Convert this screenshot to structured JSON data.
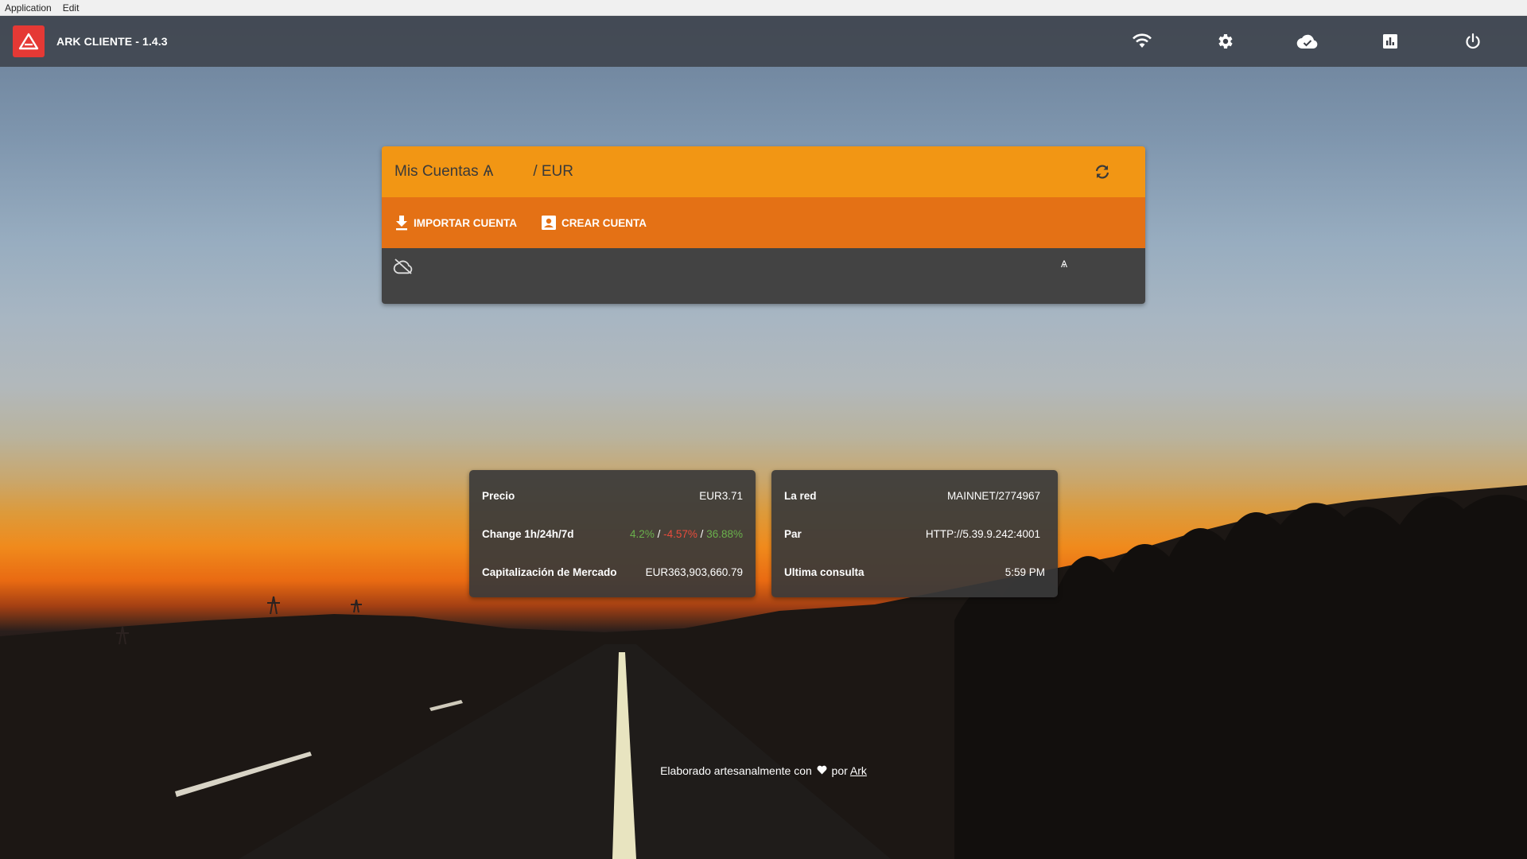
{
  "menubar": {
    "items": [
      "Application",
      "Edit"
    ]
  },
  "toolbar": {
    "title": "ARK CLIENTE - 1.4.3",
    "icons": [
      "wifi-icon",
      "settings-icon",
      "cloud-done-icon",
      "chart-icon",
      "power-icon"
    ]
  },
  "accounts": {
    "title": "Mis Cuentas",
    "symbol": "Ѧ",
    "currency": "/ EUR",
    "import_label": "IMPORTAR CUENTA",
    "create_label": "CREAR CUENTA",
    "balance_symbol": "Ѧ"
  },
  "market": {
    "price_label": "Precio",
    "price_value": "EUR3.71",
    "change_label": "Change 1h/24h/7d",
    "change_1h": "4.2%",
    "change_24h": "-4.57%",
    "change_7d": "36.88%",
    "sep": "/",
    "cap_label": "Capitalización de Mercado",
    "cap_value": "EUR363,903,660.79"
  },
  "network": {
    "net_label": "La red",
    "net_value": "MAINNET/2774967",
    "peer_label": "Par",
    "peer_value": "HTTP://5.39.9.242:4001",
    "last_label": "Ultima consulta",
    "last_value": "5:59 PM"
  },
  "footer": {
    "text": "Elaborado artesanalmente con",
    "by": "por",
    "link": "Ark"
  },
  "colors": {
    "toolbar": "#3a3e46",
    "accent_orange": "#f29614",
    "action_orange": "#e47115",
    "card_dark": "#434343",
    "logo_red": "#e53935",
    "positive": "#6ab04c",
    "negative": "#e74c3c"
  }
}
